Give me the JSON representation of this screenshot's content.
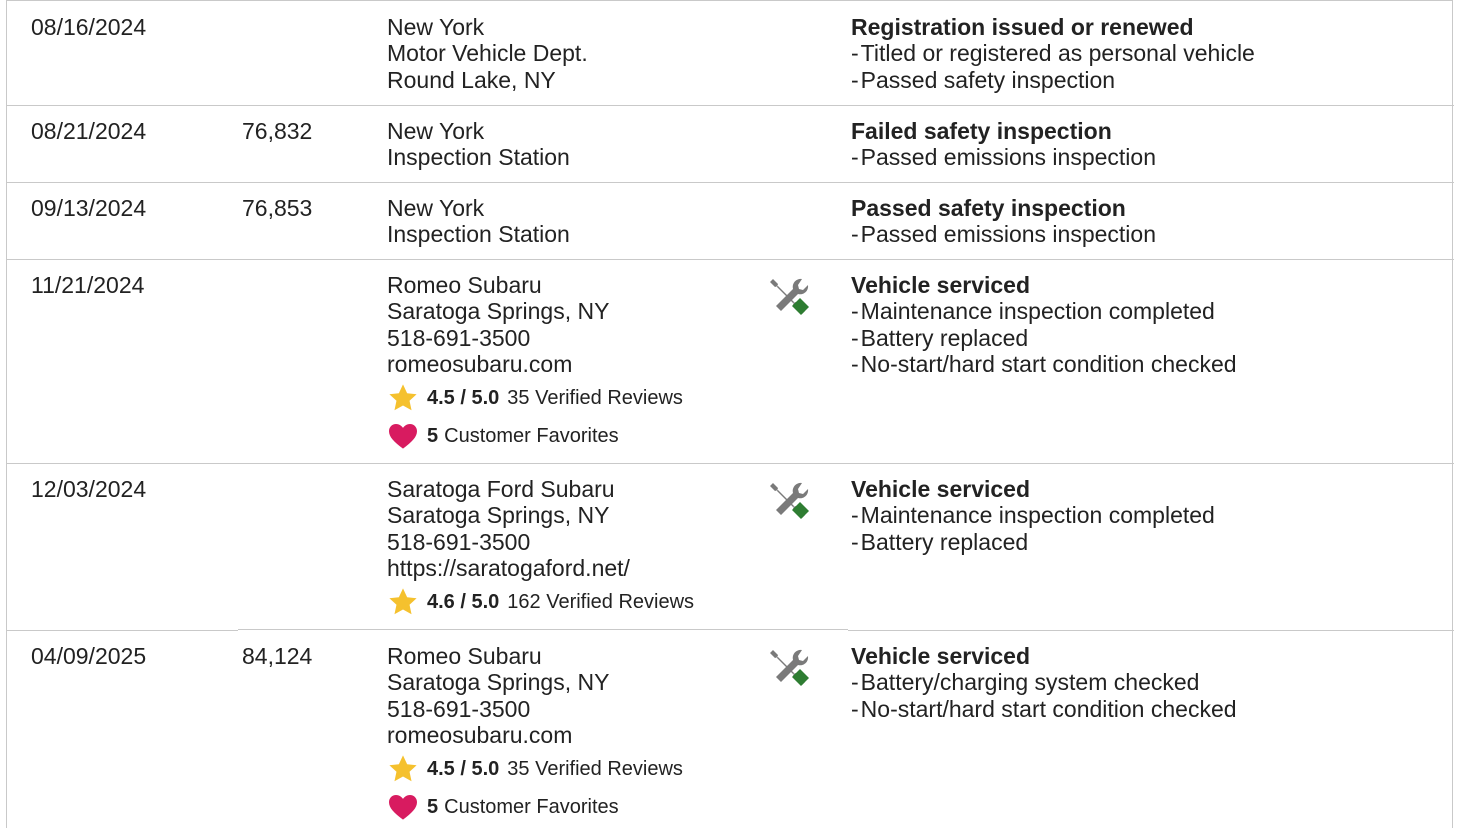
{
  "rows": [
    {
      "date": "08/16/2024",
      "mileage": "",
      "source": [
        "New York",
        "Motor Vehicle Dept.",
        "Round Lake, NY"
      ],
      "service_icon": false,
      "title": "Registration issued or renewed",
      "items": [
        "Titled or registered as personal vehicle",
        "Passed safety inspection"
      ]
    },
    {
      "date": "08/21/2024",
      "mileage": "76,832",
      "source": [
        "New York",
        "Inspection Station"
      ],
      "service_icon": false,
      "title": "Failed safety inspection",
      "items": [
        "Passed emissions inspection"
      ]
    },
    {
      "date": "09/13/2024",
      "mileage": "76,853",
      "source": [
        "New York",
        "Inspection Station"
      ],
      "service_icon": false,
      "title": "Passed safety inspection",
      "items": [
        "Passed emissions inspection"
      ]
    },
    {
      "date": "11/21/2024",
      "mileage": "",
      "source": [
        "Romeo Subaru",
        "Saratoga Springs, NY",
        "518-691-3500",
        "romeosubaru.com"
      ],
      "rating": {
        "score": "4.5 / 5.0",
        "reviews": "35 Verified Reviews"
      },
      "favorites": {
        "count": "5",
        "label": "Customer Favorites"
      },
      "service_icon": true,
      "title": "Vehicle serviced",
      "items": [
        "Maintenance inspection completed",
        "Battery replaced",
        "No-start/hard start condition checked"
      ]
    },
    {
      "date": "12/03/2024",
      "mileage": "",
      "source": [
        "Saratoga Ford Subaru",
        "Saratoga Springs, NY",
        "518-691-3500",
        "https://saratogaford.net/"
      ],
      "rating": {
        "score": "4.6 / 5.0",
        "reviews": "162 Verified Reviews"
      },
      "service_icon": true,
      "title": "Vehicle serviced",
      "items": [
        "Maintenance inspection completed",
        "Battery replaced"
      ]
    },
    {
      "date": "04/09/2025",
      "mileage": "84,124",
      "source": [
        "Romeo Subaru",
        "Saratoga Springs, NY",
        "518-691-3500",
        "romeosubaru.com"
      ],
      "rating": {
        "score": "4.5 / 5.0",
        "reviews": "35 Verified Reviews"
      },
      "favorites": {
        "count": "5",
        "label": "Customer Favorites"
      },
      "service_icon": true,
      "title": "Vehicle serviced",
      "items": [
        "Battery/charging system checked",
        "No-start/hard start condition checked"
      ]
    }
  ],
  "colors": {
    "border": "#c9c9c9",
    "star": "#f5c12e",
    "heart": "#d81b60",
    "tool_gray": "#7a7a7a",
    "tool_green": "#2e7d32"
  }
}
